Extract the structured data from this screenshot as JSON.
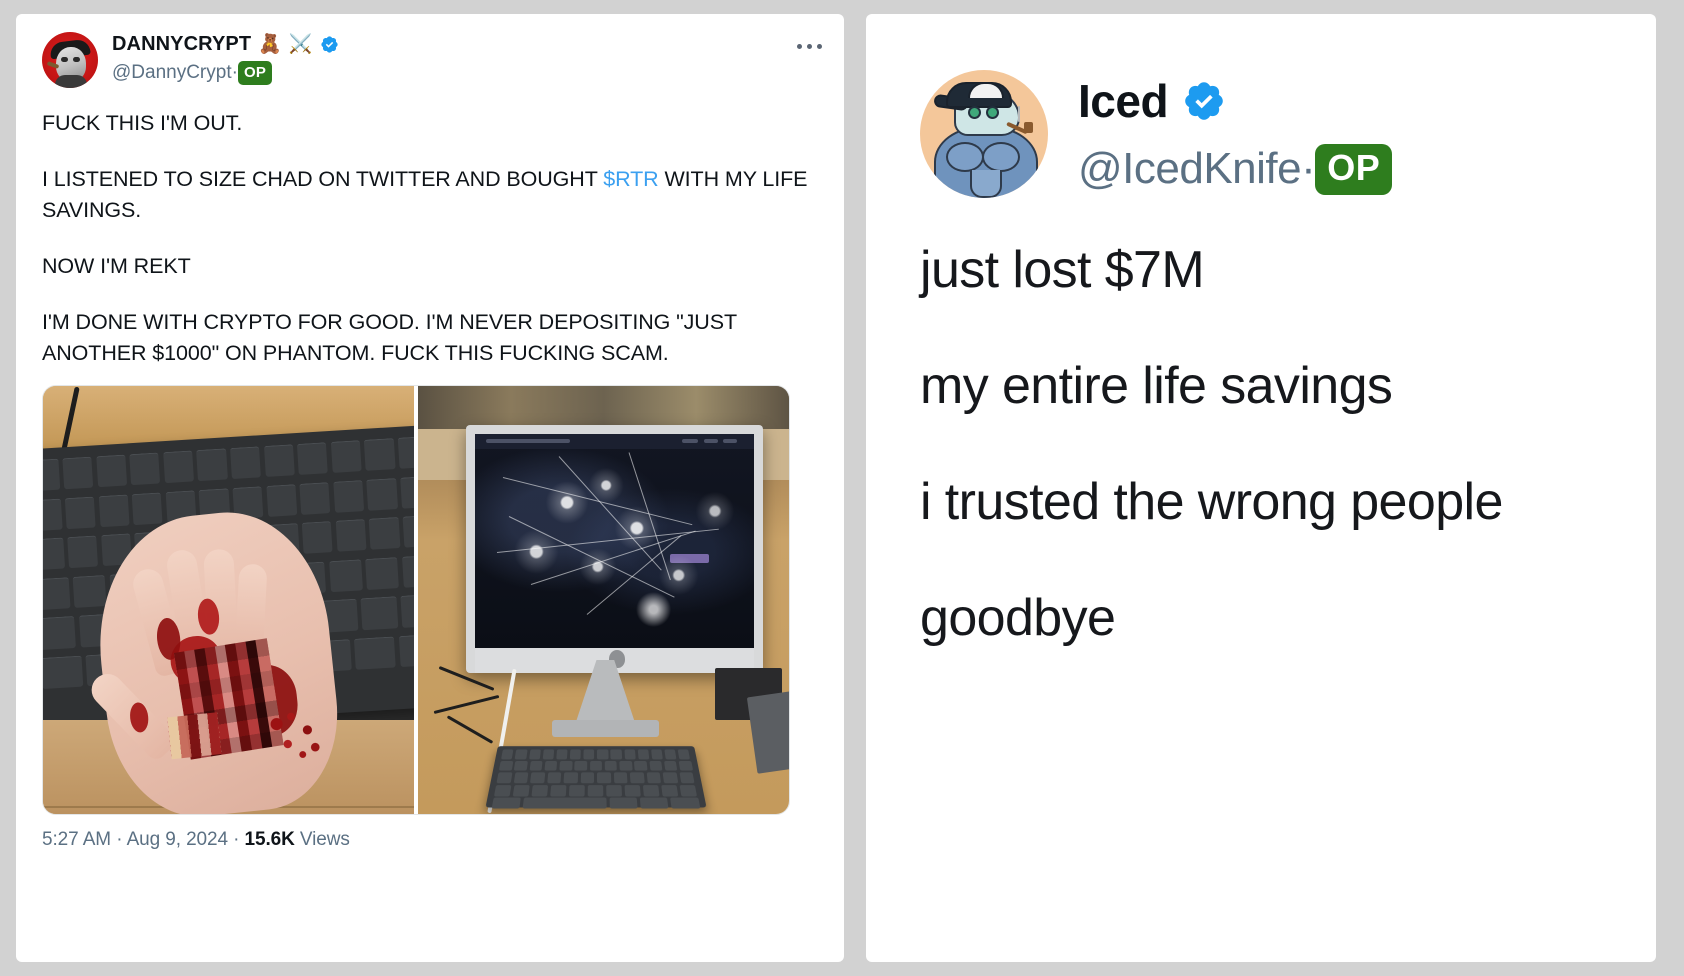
{
  "page": {
    "background_color": "#d2d2d2",
    "card_background": "#ffffff"
  },
  "left_tweet": {
    "display_name": "DANNYCRYPT",
    "name_emoji_1": "🧸",
    "name_emoji_2": "⚔️",
    "verified_icon": "verified-badge-icon",
    "handle": "@DannyCrypt·",
    "op_badge": "OP",
    "more_menu": "···",
    "avatar": "danny-crypt-avatar",
    "body": {
      "line_1": "FUCK THIS I'M OUT.",
      "line_2_before": "I LISTENED TO SIZE CHAD ON TWITTER AND BOUGHT ",
      "line_2_cashtag": "$RTR",
      "line_2_after": " WITH MY LIFE SAVINGS.",
      "line_3": "NOW I'M REKT",
      "line_4": "I'M DONE WITH CRYPTO FOR GOOD. I'M NEVER DEPOSITING \"JUST ANOTHER $1000\" ON PHANTOM. FUCK THIS FUCKING SCAM."
    },
    "media": {
      "photo_1_alt": "bloodied-hand-on-keyboard-photo",
      "photo_2_alt": "smashed-imac-screen-photo"
    },
    "footer": {
      "time": "5:27 AM",
      "sep_1": " · ",
      "date": "Aug 9, 2024",
      "sep_2": " · ",
      "views_count": "15.6K",
      "views_label": " Views"
    },
    "colors": {
      "cashtag_link": "#3ba0f0",
      "op_badge_green": "#2e7d1e",
      "verified_blue": "#1d9bf0",
      "muted_text": "#5b7083",
      "primary_text": "#0f1419"
    }
  },
  "right_tweet": {
    "display_name": "Iced",
    "verified_icon": "verified-badge-icon",
    "handle": "@IcedKnife·",
    "op_badge": "OP",
    "avatar": "iced-knife-avatar",
    "lines": [
      "just lost $7M",
      "my entire life savings",
      "i trusted the wrong people",
      "goodbye"
    ]
  }
}
